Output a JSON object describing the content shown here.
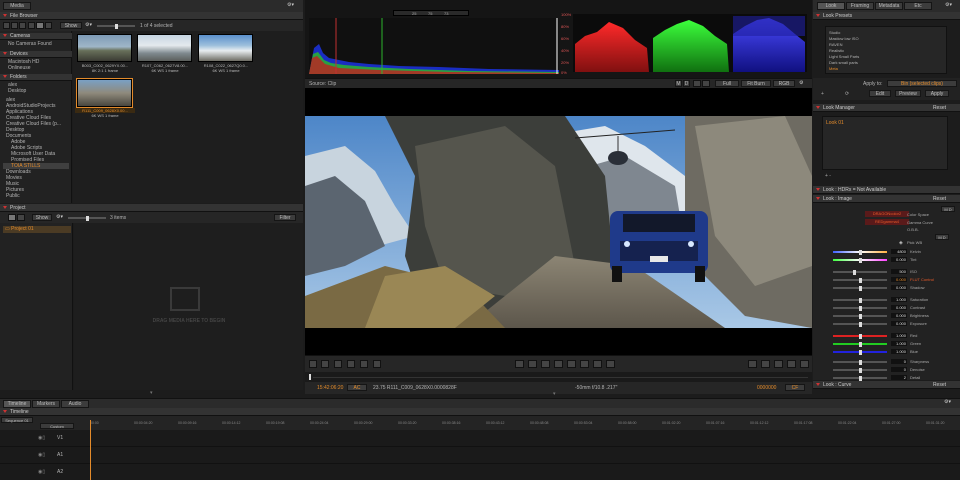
{
  "tabs_top": {
    "media": "Media"
  },
  "file_browser": {
    "title": "File Browser",
    "show": "Show",
    "count": "1 of 4 selected",
    "cameras_title": "Cameras",
    "no_cameras": "No Cameras Found",
    "devices_title": "Devices",
    "devices": [
      "Macintosh HD",
      "Onlineuse"
    ],
    "folders_title": "Folders",
    "folders_top": [
      "alex",
      "Desktop"
    ],
    "tree": [
      "alex",
      "AndroidStudioProjects",
      "Applications",
      "Creative Cloud Files",
      "Creative Cloud Files (p...",
      "Desktop",
      "Documents",
      "Adobe",
      "Adobe Scripts",
      "Microsoft User Data",
      "Promised Files",
      "TOIA STILLS",
      "Downloads",
      "Movies",
      "Music",
      "Pictures",
      "Public"
    ],
    "clips": [
      {
        "name": "B003_C002_0629YX.00...",
        "info": "8K 2:1   1 frame"
      },
      {
        "name": "R107_C062_0627V8.00...",
        "info": "6K WS   1 frame"
      },
      {
        "name": "R108_C022_0627Q0.0...",
        "info": "6K WS   1 frame"
      },
      {
        "name": "R111_C009_0628X0.00...",
        "info": "6K WS   1 frame"
      }
    ]
  },
  "project": {
    "title": "Project",
    "show": "Show",
    "items_count": "3 items",
    "filter": "Filter",
    "project_item": "Project 01",
    "drop_hint": "DRAG MEDIA HERE TO BEGIN"
  },
  "viewer": {
    "source": "Source: Clip",
    "full": "Full",
    "fit": "Fit Burn",
    "rgb": "RGB",
    "toggle_a": "M",
    "toggle_b": "D",
    "zoom_fields": [
      "25",
      "75",
      "73"
    ],
    "timecode": "15:42:06:20",
    "ac": "AC",
    "clip": "23.75 R111_C009_0628X0.0000828F",
    "lens": "-50mm f/10.8 .217\"",
    "tc_right": "0000000",
    "cf": "CF"
  },
  "right_tabs": [
    "Look",
    "Framing",
    "Metadata",
    "Etc"
  ],
  "look_presets": {
    "title": "Look Presets",
    "items": [
      "Studio",
      "Masticw low ISO",
      "RAVEN",
      "Realistic",
      "Light Small Parts",
      "Dark small parts",
      "Meta"
    ],
    "apply_to": "Apply to:",
    "apply_target": "Bin (selected clips)",
    "edit": "Edit",
    "preview": "Preview",
    "apply": "Apply"
  },
  "look_manager": {
    "title": "Look Manager",
    "reset": "Reset",
    "item": "Look 01"
  },
  "look_hdrx": {
    "title": "Look : HDRx = Not Available"
  },
  "look_image": {
    "title": "Look : Image",
    "reset": "Reset",
    "color_space": "Color Space",
    "gamma_curve": "Gamma Curve",
    "cs_val": "DRAGONcolor2",
    "gc_val": "REDgamma4",
    "obb": "O.B.B.",
    "pick_wb": "Pick WB",
    "rows": [
      {
        "label": "Kelvin",
        "value": "4800",
        "pos": 0.5
      },
      {
        "label": "Tint",
        "value": "0.000",
        "pos": 0.5
      },
      {
        "label": "ISO",
        "value": "500",
        "pos": 0.4
      },
      {
        "label": "FLUT Control",
        "value": "0.000",
        "pos": 0.5,
        "orange": true
      },
      {
        "label": "Shadow",
        "value": "0.000",
        "pos": 0.5
      },
      {
        "label": "Saturation",
        "value": "1.000",
        "pos": 0.5
      },
      {
        "label": "Contrast",
        "value": "0.000",
        "pos": 0.5
      },
      {
        "label": "Brightness",
        "value": "0.000",
        "pos": 0.5
      },
      {
        "label": "Exposure",
        "value": "0.000",
        "pos": 0.5
      },
      {
        "label": "Red",
        "value": "1.000",
        "pos": 0.5
      },
      {
        "label": "Green",
        "value": "1.000",
        "pos": 0.5
      },
      {
        "label": "Blue",
        "value": "1.000",
        "pos": 0.5
      },
      {
        "label": "Sharpness",
        "value": "0",
        "pos": 0.5
      },
      {
        "label": "Denoise",
        "value": "0",
        "pos": 0.5
      },
      {
        "label": "Detail",
        "value": "2",
        "pos": 0.5
      }
    ]
  },
  "look_curve": {
    "title": "Look : Curve",
    "reset": "Reset"
  },
  "bottom_tabs": [
    "Timeline",
    "Markers",
    "Audio"
  ],
  "timeline": {
    "title": "Timeline",
    "sequence": "Sequence 01",
    "custom": "Custom",
    "tracks": [
      "V1",
      "A1",
      "A2"
    ],
    "ticks": [
      "00:00",
      "00:00:04:20",
      "00:00:09:16",
      "00:00:14:12",
      "00:00:19:08",
      "00:00:24:04",
      "00:00:29:00",
      "00:00:33:20",
      "00:00:38:16",
      "00:00:43:12",
      "00:00:48:08",
      "00:00:53:04",
      "00:00:58:00",
      "00:01:02:20",
      "00:01:07:16",
      "00:01:12:12",
      "00:01:17:08",
      "00:01:22:04",
      "00:01:27:00",
      "00:01:31:20"
    ]
  },
  "scope_labels": [
    "100%",
    "80%",
    "60%",
    "40%",
    "20%",
    "0%"
  ],
  "colors": {
    "accent": "#e38b2b",
    "red": "#c33333",
    "panel": "#2b2b2b"
  }
}
